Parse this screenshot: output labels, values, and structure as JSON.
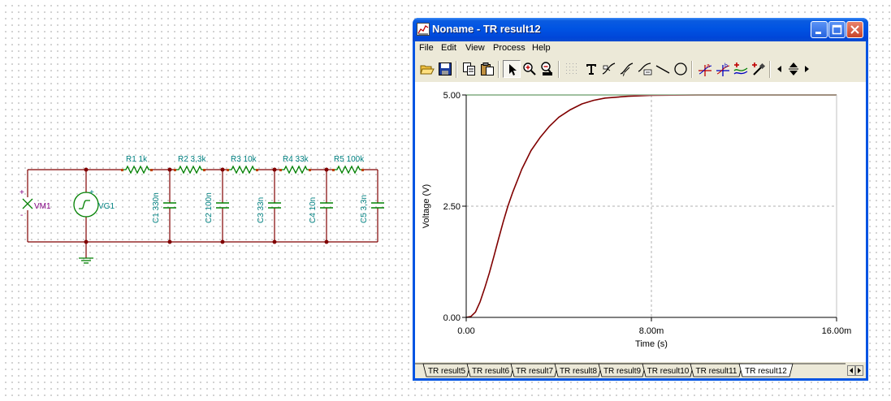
{
  "schematic": {
    "meter": "VM1",
    "source": "VG1",
    "resistors": [
      "R1 1k",
      "R2 3,3k",
      "R3 10k",
      "R4 33k",
      "R5 100k"
    ],
    "capacitors": [
      "C1 330n",
      "C2 100n",
      "C3 33n",
      "C4 10n",
      "C5 3,3n"
    ],
    "plus_sign": "+",
    "minus_sign": "-"
  },
  "window": {
    "title": "Noname - TR result12",
    "menu": [
      "File",
      "Edit",
      "View",
      "Process",
      "Help"
    ],
    "tools": [
      "open-icon",
      "save-icon",
      "copy-icon",
      "paste-icon",
      "pointer-icon",
      "zoom-in-icon",
      "zoom-100-icon",
      "grid-icon",
      "text-icon",
      "curve-label-icon",
      "curve-label-2-icon",
      "axis-label-icon",
      "line-icon",
      "circle-icon",
      "cursor-a-icon",
      "cursor-b-icon",
      "add-curve-icon",
      "pick-icon",
      "scroll-left-icon",
      "move-vertical-icon",
      "scroll-right-icon"
    ],
    "tabs": [
      "TR result5",
      "TR result6",
      "TR result7",
      "TR result8",
      "TR result9",
      "TR result10",
      "TR result11",
      "TR result12"
    ],
    "active_tab": "TR result12"
  },
  "chart_data": {
    "type": "line",
    "xlabel": "Time (s)",
    "ylabel": "Voltage (V)",
    "x_unit_scale": 0.001,
    "xlim": [
      0,
      16
    ],
    "ylim": [
      0,
      5
    ],
    "x_ticks": [
      0,
      8,
      16
    ],
    "x_tick_labels": [
      "0.00",
      "8.00m",
      "16.00m"
    ],
    "y_ticks": [
      0,
      2.5,
      5
    ],
    "y_tick_labels": [
      "0.00",
      "2.50",
      "5.00"
    ],
    "grid": true,
    "series": [
      {
        "color": "#008000",
        "x": [
          0,
          2,
          4,
          6,
          8,
          10,
          12,
          14,
          16
        ],
        "y": [
          5,
          5,
          5,
          5,
          5,
          5,
          5,
          5,
          5
        ]
      },
      {
        "color": "#800000",
        "x": [
          0,
          0.2,
          0.4,
          0.6,
          0.8,
          1.0,
          1.2,
          1.4,
          1.6,
          1.8,
          2.0,
          2.4,
          2.8,
          3.2,
          3.6,
          4.0,
          4.5,
          5.0,
          5.5,
          6.0,
          7.0,
          8.0,
          10.0,
          12.0,
          14.0,
          16.0
        ],
        "y": [
          0,
          0.02,
          0.12,
          0.35,
          0.66,
          1.0,
          1.38,
          1.77,
          2.15,
          2.5,
          2.8,
          3.33,
          3.75,
          4.05,
          4.3,
          4.5,
          4.67,
          4.8,
          4.88,
          4.93,
          4.97,
          4.99,
          5.0,
          5.0,
          5.0,
          5.0
        ]
      }
    ]
  }
}
